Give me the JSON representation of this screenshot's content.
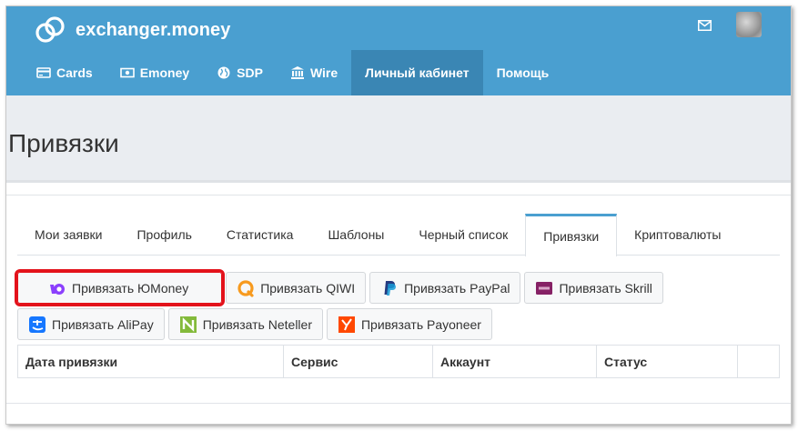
{
  "brand": {
    "name": "exchanger.money"
  },
  "header": {
    "mail_icon": "envelope-icon",
    "avatar_icon": "user-avatar"
  },
  "nav": [
    {
      "label": "Cards",
      "icon": "card-icon"
    },
    {
      "label": "Emoney",
      "icon": "money-icon"
    },
    {
      "label": "SDP",
      "icon": "globe-icon"
    },
    {
      "label": "Wire",
      "icon": "bank-icon"
    },
    {
      "label": "Личный кабинет",
      "active": true
    },
    {
      "label": "Помощь"
    }
  ],
  "page": {
    "title": "Привязки"
  },
  "tabs": [
    {
      "label": "Мои заявки"
    },
    {
      "label": "Профиль"
    },
    {
      "label": "Статистика"
    },
    {
      "label": "Шаблоны"
    },
    {
      "label": "Черный список"
    },
    {
      "label": "Привязки",
      "active": true
    },
    {
      "label": "Криптовалюты"
    }
  ],
  "bind_buttons": {
    "row1": [
      {
        "label": "Привязать ЮMoney",
        "icon": "yoomoney-icon",
        "highlighted": true
      },
      {
        "label": "Привязать QIWI",
        "icon": "qiwi-icon"
      },
      {
        "label": "Привязать PayPal",
        "icon": "paypal-icon"
      },
      {
        "label": "Привязать Skrill",
        "icon": "skrill-icon"
      }
    ],
    "row2": [
      {
        "label": "Привязать AliPay",
        "icon": "alipay-icon"
      },
      {
        "label": "Привязать Neteller",
        "icon": "neteller-icon"
      },
      {
        "label": "Привязать Payoneer",
        "icon": "payoneer-icon"
      }
    ]
  },
  "table": {
    "columns": [
      "Дата привязки",
      "Сервис",
      "Аккаунт",
      "Статус",
      ""
    ]
  },
  "colors": {
    "header": "#4a9fd0",
    "active_nav": "#3a86b4",
    "highlight": "#e3121b"
  }
}
